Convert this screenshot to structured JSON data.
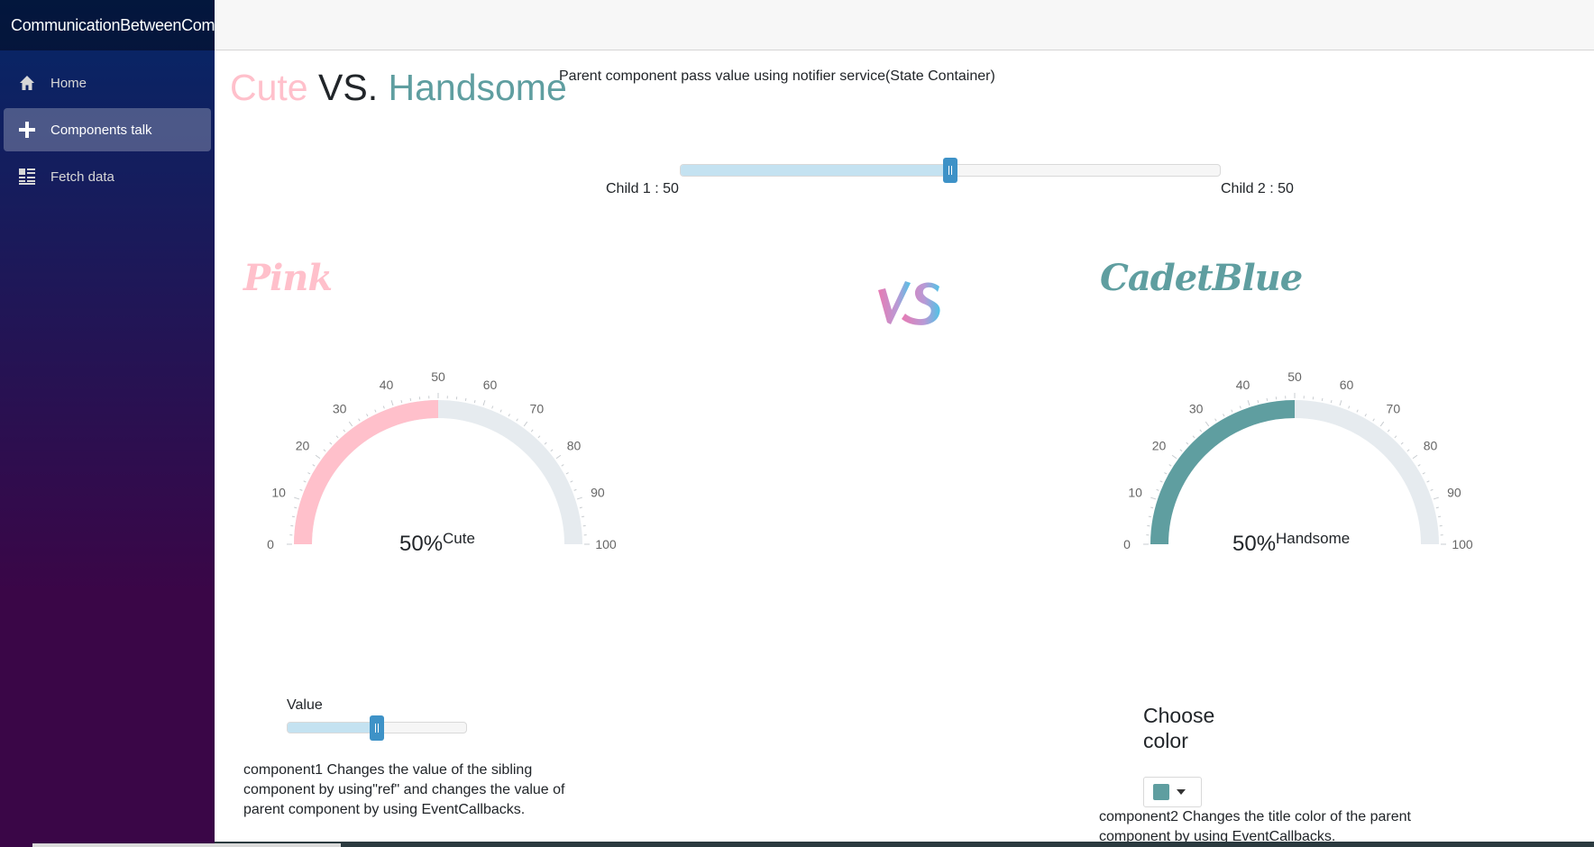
{
  "app": {
    "brand": "CommunicationBetweenComponents"
  },
  "sidebar": {
    "items": [
      {
        "label": "Home",
        "icon": "home-icon",
        "active": false
      },
      {
        "label": "Components talk",
        "icon": "plus-icon",
        "active": true
      },
      {
        "label": "Fetch data",
        "icon": "list-icon",
        "active": false
      }
    ]
  },
  "headline": {
    "cute": "Cute",
    "vs": " VS. ",
    "handsome": "Handsome"
  },
  "parent_description": "Parent component pass value using notifier service(State Container)",
  "main_slider": {
    "value": 50,
    "min": 0,
    "max": 100
  },
  "child1_label": "Child 1 : 50",
  "child2_label": "Child 2 : 50",
  "left_panel": {
    "title": "Pink",
    "title_color": "#FFC0CB",
    "gauge": {
      "value": 50,
      "value_text": "50%",
      "label": "Cute",
      "color": "#FFC0CB",
      "ticks": [
        "0",
        "10",
        "20",
        "30",
        "40",
        "50",
        "60",
        "70",
        "80",
        "90",
        "100"
      ]
    },
    "slider_label": "Value",
    "slider_value": 50,
    "description": "component1 Changes the value of the sibling component by using\"ref\" and changes the value of parent component by using EventCallbacks."
  },
  "right_panel": {
    "title": "CadetBlue",
    "title_color": "#5F9EA0",
    "gauge": {
      "value": 50,
      "value_text": "50%",
      "label": "Handsome",
      "color": "#5F9EA0",
      "ticks": [
        "0",
        "10",
        "20",
        "30",
        "40",
        "50",
        "60",
        "70",
        "80",
        "90",
        "100"
      ]
    },
    "choose_color": "Choose color",
    "selected_color": "#5F9EA0",
    "description": "component2 Changes the title color of the parent component by using EventCallbacks."
  },
  "vs_logo": "vs-logo-icon"
}
